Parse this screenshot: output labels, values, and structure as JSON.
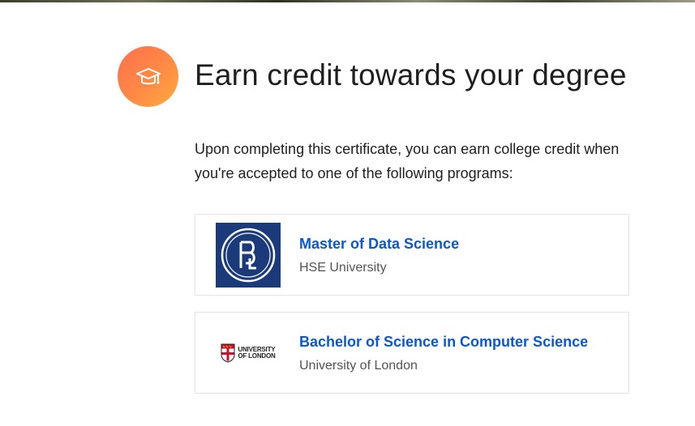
{
  "header": {
    "title": "Earn credit towards your degree",
    "icon": "graduation-cap-icon"
  },
  "intro": {
    "text": "Upon completing this certificate, you can earn college credit when you're accepted to one of the following programs:"
  },
  "programs": [
    {
      "title": "Master of Data Science",
      "school": "HSE University",
      "logo": "hse-university-logo"
    },
    {
      "title": "Bachelor of Science in Computer Science",
      "school": "University of London",
      "logo": "university-of-london-logo",
      "logo_text": [
        "UNIVERSITY",
        "OF LONDON"
      ]
    }
  ],
  "colors": {
    "accent_gradient_start": "#ff6f4e",
    "accent_gradient_end": "#ffab3d",
    "link": "#0a57d0",
    "hse_blue": "#1a3a7a",
    "uol_red": "#c8102e"
  }
}
